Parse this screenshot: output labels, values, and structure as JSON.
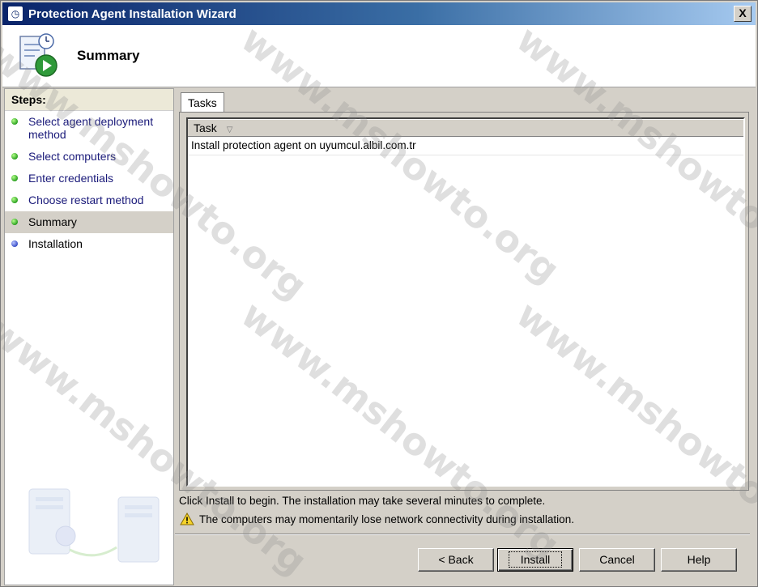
{
  "window": {
    "title": "Protection Agent Installation Wizard",
    "close_glyph": "X"
  },
  "header": {
    "title": "Summary"
  },
  "steps": {
    "title": "Steps:",
    "items": [
      {
        "label": "Select agent deployment method",
        "state": "done"
      },
      {
        "label": "Select computers",
        "state": "done"
      },
      {
        "label": "Enter credentials",
        "state": "done"
      },
      {
        "label": "Choose restart method",
        "state": "done"
      },
      {
        "label": "Summary",
        "state": "current"
      },
      {
        "label": "Installation",
        "state": "pending"
      }
    ]
  },
  "tabs": [
    {
      "label": "Tasks",
      "active": true
    }
  ],
  "task_list": {
    "columns": [
      "Task"
    ],
    "rows": [
      "Install protection agent on uyumcul.albil.com.tr"
    ]
  },
  "messages": {
    "info": "Click Install to begin. The installation may take several minutes to complete.",
    "warning": "The computers may momentarily lose network connectivity during installation."
  },
  "buttons": {
    "back": "< Back",
    "install": "Install",
    "cancel": "Cancel",
    "help": "Help"
  },
  "watermark": "www.mshowto.org",
  "colors": {
    "titlebar_start": "#0a246a",
    "titlebar_end": "#a6caf0",
    "step_done": "#2aa020",
    "step_pending": "#3a4fc8"
  },
  "icons": {
    "app": "clock-shield-icon",
    "header": "summary-play-icon",
    "warning": "warning-icon",
    "sort": "sort-triangle-icon"
  }
}
